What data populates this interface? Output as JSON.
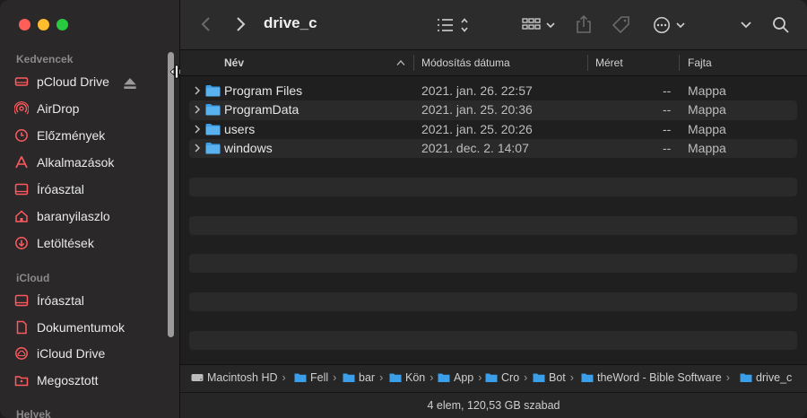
{
  "window": {
    "title": "drive_c"
  },
  "sidebar": {
    "sections": [
      {
        "label": "Kedvencek"
      },
      {
        "label": "iCloud"
      },
      {
        "label": "Helyek"
      }
    ],
    "favorites": [
      {
        "label": "pCloud Drive",
        "icon": "drive-icon"
      },
      {
        "label": "AirDrop",
        "icon": "airdrop-icon"
      },
      {
        "label": "Előzmények",
        "icon": "clock-icon"
      },
      {
        "label": "Alkalmazások",
        "icon": "apps-icon"
      },
      {
        "label": "Íróasztal",
        "icon": "desktop-icon"
      },
      {
        "label": "baranyilaszlo",
        "icon": "home-icon"
      },
      {
        "label": "Letöltések",
        "icon": "download-icon"
      }
    ],
    "icloud": [
      {
        "label": "Íróasztal",
        "icon": "desktop-icon"
      },
      {
        "label": "Dokumentumok",
        "icon": "document-icon"
      },
      {
        "label": "iCloud Drive",
        "icon": "cloud-icon"
      },
      {
        "label": "Megosztott",
        "icon": "shared-folder-icon"
      }
    ],
    "accent": "#ff5a5f"
  },
  "columns": {
    "name": "Név",
    "modified": "Módosítás dátuma",
    "size": "Méret",
    "kind": "Fajta"
  },
  "files": [
    {
      "name": "Program Files",
      "modified": "2021. jan. 26. 22:57",
      "size": "--",
      "kind": "Mappa"
    },
    {
      "name": "ProgramData",
      "modified": "2021. jan. 25. 20:36",
      "size": "--",
      "kind": "Mappa"
    },
    {
      "name": "users",
      "modified": "2021. jan. 25. 20:26",
      "size": "--",
      "kind": "Mappa"
    },
    {
      "name": "windows",
      "modified": "2021. dec. 2. 14:07",
      "size": "--",
      "kind": "Mappa"
    }
  ],
  "pathbar": [
    {
      "label": "Macintosh HD"
    },
    {
      "label": "Fell"
    },
    {
      "label": "bar"
    },
    {
      "label": "Kön"
    },
    {
      "label": "App"
    },
    {
      "label": "Cro"
    },
    {
      "label": "Bot"
    },
    {
      "label": "theWord - Bible Software"
    },
    {
      "label": "drive_c"
    }
  ],
  "status": {
    "text": "4 elem, 120,53 GB szabad"
  },
  "colors": {
    "folder": "#3a9ee8",
    "sidebar_icon": "#ff5a5f"
  }
}
